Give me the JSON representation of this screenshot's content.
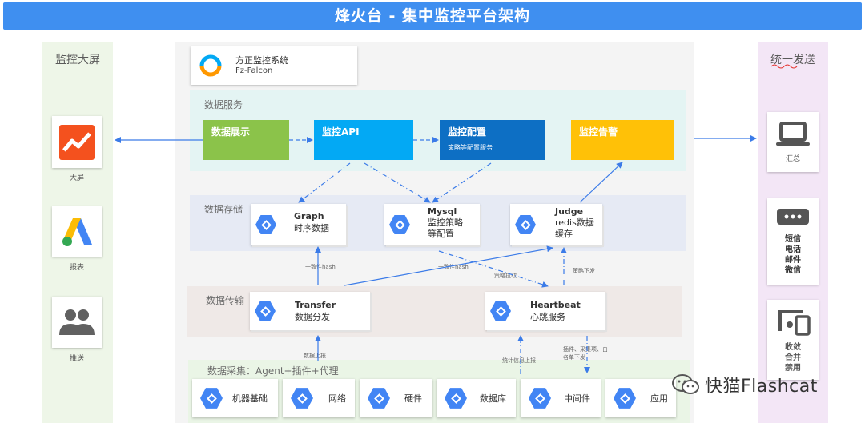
{
  "title": "烽火台 - 集中监控平台架构",
  "left_panel": {
    "title": "监控大屏",
    "items": [
      {
        "label": "大屏"
      },
      {
        "label": "报表"
      },
      {
        "label": "推送"
      }
    ]
  },
  "right_panel": {
    "title": "统一发送",
    "items": [
      {
        "label": "汇总"
      },
      {
        "label": "短信\n电话\n邮件\n微信"
      },
      {
        "label": "收敛\n合并\n禁用"
      }
    ]
  },
  "logo": {
    "title": "方正监控系统",
    "subtitle": "Fz-Falcon"
  },
  "bands": {
    "service": "数据服务",
    "storage": "数据存储",
    "transport": "数据传输",
    "collect": "数据采集：Agent+插件+代理"
  },
  "services": [
    {
      "label": "数据展示",
      "sub": "",
      "color": "#8bc34a"
    },
    {
      "label": "监控API",
      "sub": "",
      "color": "#03a9f4"
    },
    {
      "label": "监控配置",
      "sub": "策略等配置服务",
      "color": "#0d6fc4"
    },
    {
      "label": "监控告警",
      "sub": "",
      "color": "#ffc107"
    }
  ],
  "storage": [
    {
      "name": "Graph",
      "desc": "时序数据"
    },
    {
      "name": "Mysql",
      "desc": "监控策略\n等配置"
    },
    {
      "name": "Judge",
      "desc": "redis数据\n缓存"
    }
  ],
  "transport": [
    {
      "name": "Transfer",
      "desc": "数据分发"
    },
    {
      "name": "Heartbeat",
      "desc": "心跳服务"
    }
  ],
  "collect": [
    {
      "label": "机器基础"
    },
    {
      "label": "网络"
    },
    {
      "label": "硬件"
    },
    {
      "label": "数据库"
    },
    {
      "label": "中间件"
    },
    {
      "label": "应用"
    }
  ],
  "edge_labels": {
    "hash1": "一致性hash",
    "hash2": "一致性hash",
    "strategy_fetch": "策略拉取",
    "strategy_push": "策略下发",
    "data_report": "数据上报",
    "stats_report": "统计信息上报",
    "plugin_push": "插件、采集项、白\n名单下发"
  },
  "brand": {
    "text": "快猫Flashcat"
  },
  "colors": {
    "arrow": "#3b7be8",
    "accent": "#3f8ff0",
    "hex": "#4285f4"
  }
}
